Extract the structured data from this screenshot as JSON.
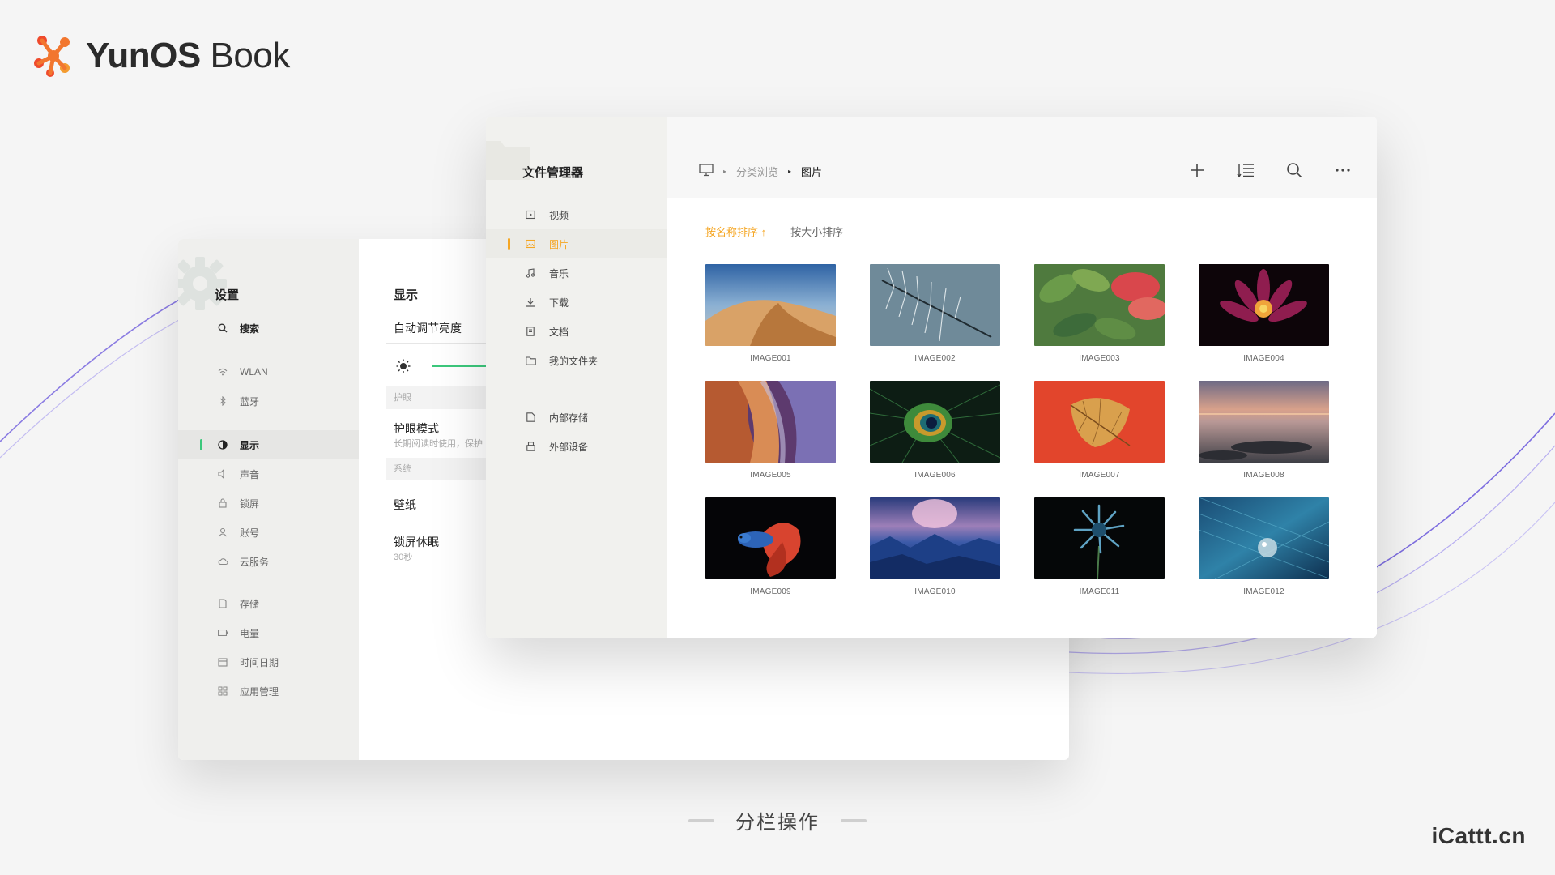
{
  "brand": {
    "name_bold": "YunOS",
    "name_light": " Book"
  },
  "caption": "分栏操作",
  "watermark": "iCattt.cn",
  "settings": {
    "title": "设置",
    "search_label": "搜索",
    "items": [
      {
        "label": "WLAN",
        "icon": "wifi-icon"
      },
      {
        "label": "蓝牙",
        "icon": "bluetooth-icon"
      },
      {
        "label": "显示",
        "icon": "display-icon",
        "active": true
      },
      {
        "label": "声音",
        "icon": "speaker-icon"
      },
      {
        "label": "锁屏",
        "icon": "lock-icon"
      },
      {
        "label": "账号",
        "icon": "user-icon"
      },
      {
        "label": "云服务",
        "icon": "cloud-icon"
      },
      {
        "label": "存储",
        "icon": "storage-icon"
      },
      {
        "label": "电量",
        "icon": "battery-icon"
      },
      {
        "label": "时间日期",
        "icon": "calendar-icon"
      },
      {
        "label": "应用管理",
        "icon": "apps-grid-icon"
      }
    ],
    "main": {
      "title": "显示",
      "auto_brightness": "自动调节亮度",
      "section_eye": "护眼",
      "eye_mode": "护眼模式",
      "eye_mode_desc": "长期阅读时使用，保护",
      "section_system": "系统",
      "wallpaper": "壁纸",
      "lock_sleep": "锁屏休眠",
      "lock_sleep_value": "30秒"
    },
    "accent_color": "#3cc87c"
  },
  "file_manager": {
    "title": "文件管理器",
    "items": [
      {
        "label": "视频",
        "icon": "video-icon"
      },
      {
        "label": "图片",
        "icon": "image-icon",
        "active": true
      },
      {
        "label": "音乐",
        "icon": "music-icon"
      },
      {
        "label": "下载",
        "icon": "download-icon"
      },
      {
        "label": "文档",
        "icon": "document-icon"
      },
      {
        "label": "我的文件夹",
        "icon": "folder-icon"
      },
      {
        "label": "内部存储",
        "icon": "internal-storage-icon"
      },
      {
        "label": "外部设备",
        "icon": "external-device-icon"
      }
    ],
    "breadcrumb": {
      "root_icon": "monitor-icon",
      "level1": "分类浏览",
      "current": "图片"
    },
    "tools": [
      "add-icon",
      "sort-list-icon",
      "search-icon",
      "more-icon"
    ],
    "sort": {
      "by_name": "按名称排序 ↑",
      "by_size": "按大小排序"
    },
    "images": [
      {
        "name": "IMAGE001",
        "theme": "desert"
      },
      {
        "name": "IMAGE002",
        "theme": "pine-branch"
      },
      {
        "name": "IMAGE003",
        "theme": "feathers"
      },
      {
        "name": "IMAGE004",
        "theme": "water-lily"
      },
      {
        "name": "IMAGE005",
        "theme": "canyon"
      },
      {
        "name": "IMAGE006",
        "theme": "peacock-feather"
      },
      {
        "name": "IMAGE007",
        "theme": "dry-leaf"
      },
      {
        "name": "IMAGE008",
        "theme": "sunset-shore"
      },
      {
        "name": "IMAGE009",
        "theme": "betta-fish"
      },
      {
        "name": "IMAGE010",
        "theme": "aurora-mountains"
      },
      {
        "name": "IMAGE011",
        "theme": "blue-flower"
      },
      {
        "name": "IMAGE012",
        "theme": "water-drop"
      }
    ],
    "accent_color": "#f5a623"
  }
}
